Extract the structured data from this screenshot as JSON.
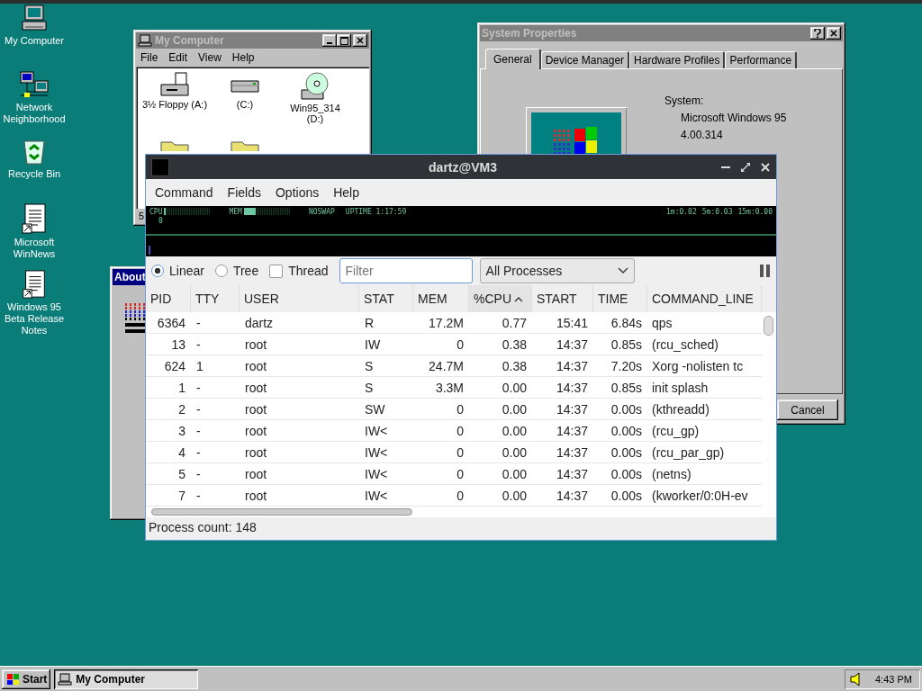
{
  "desktop_icons": [
    {
      "label": "My Computer",
      "kind": "computer"
    },
    {
      "label": "Network Neighborhood",
      "kind": "network"
    },
    {
      "label": "Recycle Bin",
      "kind": "recycle"
    },
    {
      "label": "Microsoft WinNews",
      "kind": "document"
    },
    {
      "label": "Windows 95 Beta Release Notes",
      "kind": "document"
    }
  ],
  "my_computer": {
    "title": "My Computer",
    "active": false,
    "menu": [
      "File",
      "Edit",
      "View",
      "Help"
    ],
    "items": [
      {
        "label": "3½ Floppy (A:)",
        "kind": "floppy"
      },
      {
        "label": "(C:)",
        "kind": "disk"
      },
      {
        "label": "Win95_314 (D:)",
        "kind": "cd"
      },
      {
        "kind": "folder"
      },
      {
        "kind": "folder"
      }
    ],
    "status": "5"
  },
  "system_properties": {
    "title": "System Properties",
    "active": false,
    "tabs": [
      {
        "label": "General",
        "selected": true
      },
      {
        "label": "Device Manager",
        "selected": false
      },
      {
        "label": "Hardware Profiles",
        "selected": false
      },
      {
        "label": "Performance",
        "selected": false
      }
    ],
    "system_label": "System:",
    "system_lines": [
      "Microsoft Windows 95",
      "4.00.314"
    ],
    "cancel": "Cancel"
  },
  "about_window": {
    "title": "About",
    "active": true
  },
  "qps": {
    "title": "dartz@VM3",
    "menu": [
      "Command",
      "Fields",
      "Options",
      "Help"
    ],
    "monitor": {
      "cpu_label": "CPU",
      "cpu": {
        "level": 0.03
      },
      "mem_label": "MEM",
      "mem": {
        "level": 0.25
      },
      "swap": "NOSWAP",
      "uptime": "UPTIME 1:17:59",
      "axis": "0",
      "loads": [
        "1m:0.02",
        "5m:0.03",
        "15m:0.00"
      ]
    },
    "view_modes": [
      {
        "label": "Linear",
        "kind": "radio",
        "checked": true
      },
      {
        "label": "Tree",
        "kind": "radio",
        "checked": false
      },
      {
        "label": "Thread",
        "kind": "checkbox",
        "checked": false
      }
    ],
    "filter": {
      "placeholder": "Filter"
    },
    "process_filter": "All Processes",
    "columns": [
      {
        "label": "PID",
        "sorted": false
      },
      {
        "label": "TTY",
        "sorted": false
      },
      {
        "label": "USER",
        "sorted": false
      },
      {
        "label": "STAT",
        "sorted": false
      },
      {
        "label": "MEM",
        "sorted": false
      },
      {
        "label": "%CPU",
        "sorted": true
      },
      {
        "label": "START",
        "sorted": false
      },
      {
        "label": "TIME",
        "sorted": false
      },
      {
        "label": "COMMAND_LINE",
        "sorted": false
      }
    ],
    "rows": [
      [
        "6364",
        "-",
        "dartz",
        "R",
        "17.2M",
        "0.77",
        "15:41",
        "6.84s",
        "qps"
      ],
      [
        "13",
        "-",
        "root",
        "IW",
        "0",
        "0.38",
        "14:37",
        "0.85s",
        "(rcu_sched)"
      ],
      [
        "624",
        "1",
        "root",
        "S",
        "24.7M",
        "0.38",
        "14:37",
        "7.20s",
        "Xorg -nolisten tc"
      ],
      [
        "1",
        "-",
        "root",
        "S",
        "3.3M",
        "0.00",
        "14:37",
        "0.85s",
        "init splash"
      ],
      [
        "2",
        "-",
        "root",
        "SW",
        "0",
        "0.00",
        "14:37",
        "0.00s",
        "(kthreadd)"
      ],
      [
        "3",
        "-",
        "root",
        "IW<",
        "0",
        "0.00",
        "14:37",
        "0.00s",
        "(rcu_gp)"
      ],
      [
        "4",
        "-",
        "root",
        "IW<",
        "0",
        "0.00",
        "14:37",
        "0.00s",
        "(rcu_par_gp)"
      ],
      [
        "5",
        "-",
        "root",
        "IW<",
        "0",
        "0.00",
        "14:37",
        "0.00s",
        "(netns)"
      ],
      [
        "7",
        "-",
        "root",
        "IW<",
        "0",
        "0.00",
        "14:37",
        "0.00s",
        "(kworker/0:0H-ev"
      ]
    ],
    "status": "Process count: 148"
  },
  "taskbar": {
    "start": "Start",
    "tasks": [
      {
        "label": "My Computer",
        "selected": true
      }
    ],
    "clock": "4:43 PM"
  }
}
